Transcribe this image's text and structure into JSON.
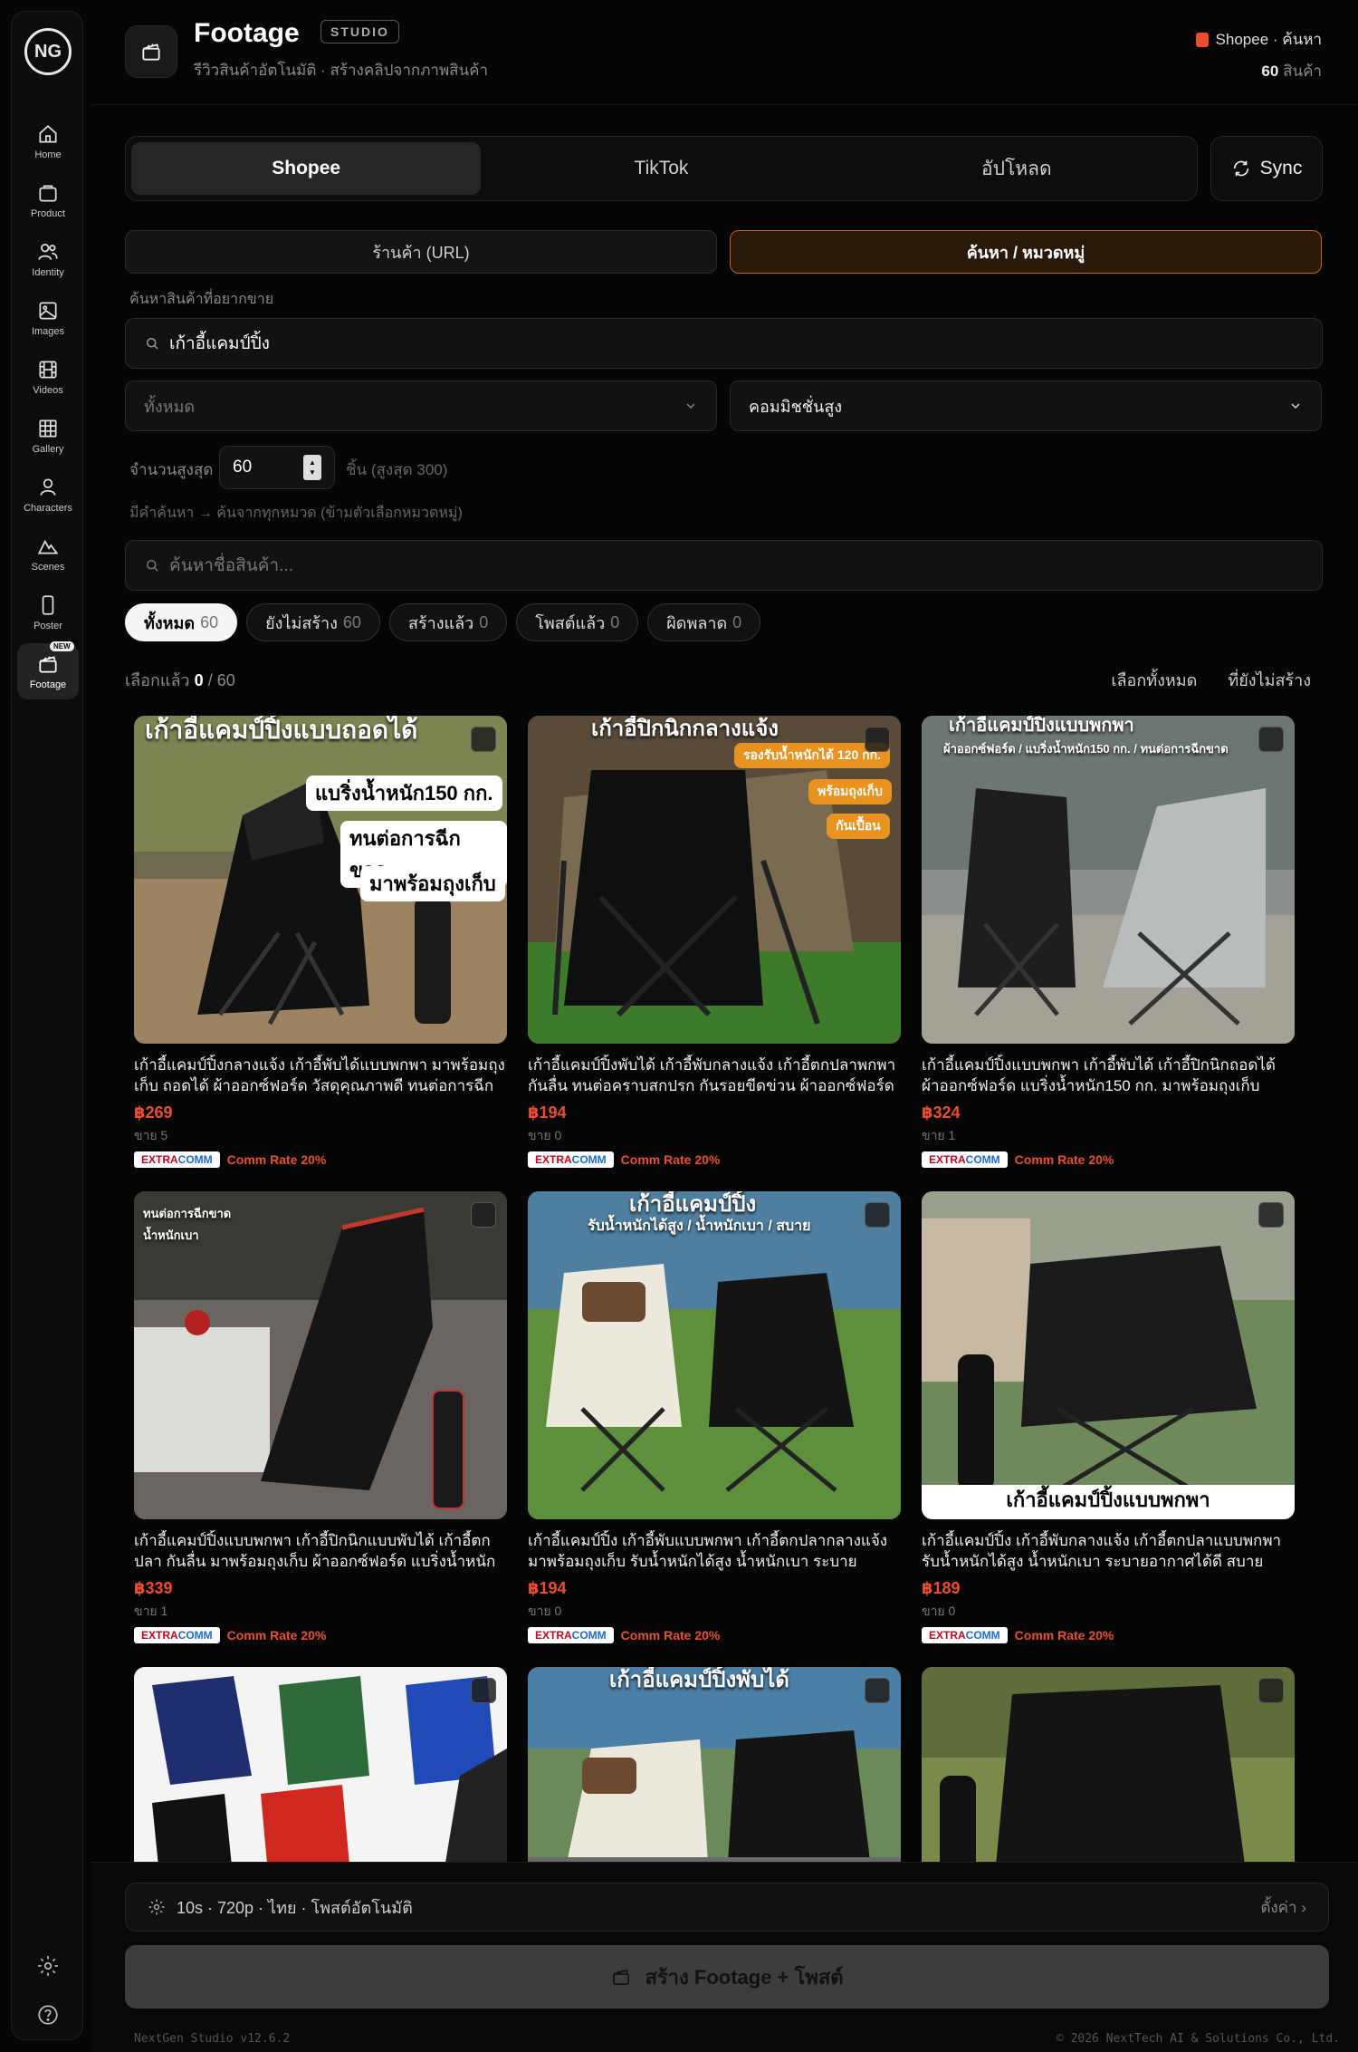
{
  "sidebar": {
    "logo": "NG",
    "items": [
      {
        "label": "Home",
        "icon": "home-icon"
      },
      {
        "label": "Product",
        "icon": "bag-icon"
      },
      {
        "label": "Identity",
        "icon": "users-icon"
      },
      {
        "label": "Images",
        "icon": "image-icon"
      },
      {
        "label": "Videos",
        "icon": "film-icon"
      },
      {
        "label": "Gallery",
        "icon": "grid-icon"
      },
      {
        "label": "Characters",
        "icon": "person-icon"
      },
      {
        "label": "Scenes",
        "icon": "mountain-icon"
      },
      {
        "label": "Poster",
        "icon": "phone-icon"
      },
      {
        "label": "Footage",
        "icon": "clapper-icon",
        "badge": "NEW"
      }
    ]
  },
  "header": {
    "title": "Footage",
    "badge": "STUDIO",
    "subtitle": "รีวิวสินค้าอัตโนมัติ · สร้างคลิปจากภาพสินค้า",
    "source": "Shopee · ค้นหา",
    "count": "60",
    "count_unit": "สินค้า"
  },
  "tabs": [
    "Shopee",
    "TikTok",
    "อัปโหลด"
  ],
  "sync_label": "Sync",
  "modes": [
    "ร้านค้า (URL)",
    "ค้นหา / หมวดหมู่"
  ],
  "search": {
    "label": "ค้นหาสินค้าที่อยากขาย",
    "value": "เก้าอี้แคมป์ปิ้ง"
  },
  "category_select": "ทั้งหมด",
  "sort_select": "คอมมิชชั่นสูง",
  "quantity": {
    "label": "จำนวนสูงสุด",
    "value": "60",
    "hint": "ชิ้น (สูงสุด 300)"
  },
  "keyword_hint": "มีคำค้นหา → ค้นจากทุกหมวด (ข้ามตัวเลือกหมวดหมู่)",
  "filter_placeholder": "ค้นหาชื่อสินค้า...",
  "chips": [
    {
      "label": "ทั้งหมด",
      "count": "60"
    },
    {
      "label": "ยังไม่สร้าง",
      "count": "60"
    },
    {
      "label": "สร้างแล้ว",
      "count": "0"
    },
    {
      "label": "โพสต์แล้ว",
      "count": "0"
    },
    {
      "label": "ผิดพลาด",
      "count": "0"
    }
  ],
  "selection": {
    "label": "เลือกแล้ว",
    "selected": "0",
    "total": "/ 60"
  },
  "select_all": "เลือกทั้งหมด",
  "select_not_created": "ที่ยังไม่สร้าง",
  "products": [
    {
      "title": "เก้าอี้แคมป์ปิ้งกลางแจ้ง เก้าอี้พับได้แบบพกพา มาพร้อมถุงเก็บ ถอดได้ ผ้าออกซ์ฟอร์ด วัสดุคุณภาพดี ทนต่อการฉีกขาด",
      "price": "฿269",
      "sold": "ขาย 5",
      "overlay_top": "เก้าอี้แคมป์ปิ้งแบบถอดได้",
      "overlay_lines": [
        "แบริ่งน้ำหนัก150 กก.",
        "ทนต่อการฉีกขาด",
        "มาพร้อมถุงเก็บ"
      ]
    },
    {
      "title": "เก้าอี้แคมป์ปิ้งพับได้ เก้าอี้พับกลางแจ้ง เก้าอี้ตกปลาพกพา กันลื่น ทนต่อคราบสกปรก กันรอยขีดข่วน ผ้าออกซ์ฟอร์ด",
      "price": "฿194",
      "sold": "ขาย 0",
      "overlay_top": "เก้าอี้ปิกนิกกลางแจ้ง",
      "overlay_lines": [
        "รองรับน้ำหนักได้ 120 กก.",
        "พร้อมถุงเก็บ",
        "กันเปื้อน"
      ]
    },
    {
      "title": "เก้าอี้แคมป์ปิ้งแบบพกพา เก้าอี้พับได้ เก้าอี้ปิกนิกถอดได้ ผ้าออกซ์ฟอร์ด แบริ่งน้ำหนัก150 กก. มาพร้อมถุงเก็บ",
      "price": "฿324",
      "sold": "ขาย 1",
      "overlay_top": "เก้าอี้แคมป์ปิ้งแบบพกพา",
      "overlay_lines": [
        "ผ้าออกซ์ฟอร์ด / แบริ่งน้ำหนัก150 กก. / ทนต่อการฉีกขาด"
      ]
    },
    {
      "title": "เก้าอี้แคมป์ปิ้งแบบพกพา เก้าอี้ปิกนิกแบบพับได้ เก้าอี้ตกปลา กันลื่น มาพร้อมถุงเก็บ ผ้าออกซ์ฟอร์ด แบริ่งน้ำหนัก",
      "price": "฿339",
      "sold": "ขาย 1",
      "overlay_top": "",
      "overlay_lines": [
        "ทนต่อการฉีกขาด",
        "น้ำหนักเบา"
      ]
    },
    {
      "title": "เก้าอี้แคมป์ปิ้ง เก้าอี้พับแบบพกพา เก้าอี้ตกปลากลางแจ้ง มาพร้อมถุงเก็บ รับน้ำหนักได้สูง น้ำหนักเบา ระบายอากาศได้ดี",
      "price": "฿194",
      "sold": "ขาย 0",
      "overlay_top": "เก้าอี้แคมป์ปิ้ง",
      "overlay_lines": [
        "รับน้ำหนักได้สูง / น้ำหนักเบา / สบาย"
      ]
    },
    {
      "title": "เก้าอี้แคมป์ปิ้ง เก้าอี้พับกลางแจ้ง เก้าอี้ตกปลาแบบพกพา รับน้ำหนักได้สูง น้ำหนักเบา ระบายอากาศได้ดี สบาย",
      "price": "฿189",
      "sold": "ขาย 0",
      "overlay_top": "",
      "overlay_lines": [
        "เก้าอี้แคมป์ปิ้งแบบพกพา"
      ]
    },
    {
      "title": "",
      "price": "",
      "sold": "",
      "overlay_top": "",
      "overlay_lines": []
    },
    {
      "title": "",
      "price": "",
      "sold": "",
      "overlay_top": "เก้าอี้แคมป์ปิ้งพับได้",
      "overlay_lines": []
    },
    {
      "title": "",
      "price": "",
      "sold": "",
      "overlay_top": "",
      "overlay_lines": []
    }
  ],
  "extracomm": {
    "a": "EXTRA",
    "b": "COMM"
  },
  "comm_rate": "Comm Rate 20%",
  "settings_summary": "10s · 720p · ไทย · โพสต์อัตโนมัติ",
  "settings_link": "ตั้งค่า",
  "create_button": "สร้าง Footage + โพสต์",
  "footer_left": "NextGen Studio v12.6.2",
  "footer_right": "© 2026 NextTech AI & Solutions Co., Ltd."
}
